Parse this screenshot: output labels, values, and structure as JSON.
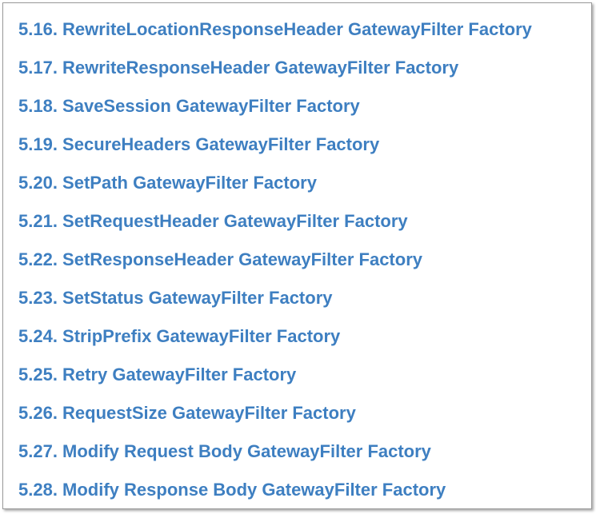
{
  "toc": {
    "items": [
      {
        "label": "5.16. RewriteLocationResponseHeader GatewayFilter Factory"
      },
      {
        "label": "5.17. RewriteResponseHeader GatewayFilter Factory"
      },
      {
        "label": "5.18. SaveSession GatewayFilter Factory"
      },
      {
        "label": "5.19. SecureHeaders GatewayFilter Factory"
      },
      {
        "label": "5.20. SetPath GatewayFilter Factory"
      },
      {
        "label": "5.21. SetRequestHeader GatewayFilter Factory"
      },
      {
        "label": "5.22. SetResponseHeader GatewayFilter Factory"
      },
      {
        "label": "5.23. SetStatus GatewayFilter Factory"
      },
      {
        "label": "5.24. StripPrefix GatewayFilter Factory"
      },
      {
        "label": "5.25. Retry GatewayFilter Factory"
      },
      {
        "label": "5.26. RequestSize GatewayFilter Factory"
      },
      {
        "label": "5.27. Modify Request Body GatewayFilter Factory"
      },
      {
        "label": "5.28. Modify Response Body GatewayFilter Factory"
      }
    ]
  },
  "colors": {
    "link": "#3e7fc1",
    "border": "#9a9a9a",
    "background": "#ffffff"
  }
}
